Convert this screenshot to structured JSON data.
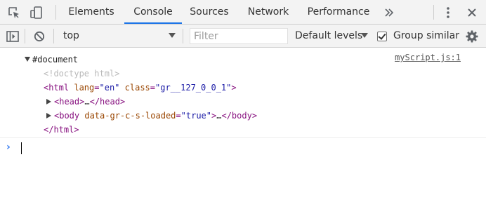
{
  "tabs": [
    {
      "label": "Elements",
      "active": false
    },
    {
      "label": "Console",
      "active": true
    },
    {
      "label": "Sources",
      "active": false
    },
    {
      "label": "Network",
      "active": false
    },
    {
      "label": "Performance",
      "active": false
    }
  ],
  "toolbar": {
    "context": "top",
    "filter_placeholder": "Filter",
    "levels": "Default levels",
    "group_similar": "Group similar",
    "group_similar_checked": true
  },
  "console": {
    "document_label": "#document",
    "source_link": "myScript.js:1",
    "doctype": "<!doctype html>",
    "html_open": {
      "tag_open": "<html",
      "attr1": "lang",
      "val1": "\"en\"",
      "attr2": "class",
      "val2": "\"gr__127_0_0_1\"",
      "tag_close": ">"
    },
    "head": {
      "open": "<head>",
      "ellipsis": "…",
      "close": "</head>"
    },
    "body": {
      "open": "<body",
      "attr": "data-gr-c-s-loaded",
      "val": "\"true\"",
      "gt": ">",
      "ellipsis": "…",
      "close": "</body>"
    },
    "html_close": "</html>",
    "prompt": "›"
  },
  "colors": {
    "accent": "#1a73e8",
    "tag": "#881280",
    "attr": "#994500",
    "value": "#1a1aa6",
    "prompt": "#367cf1"
  }
}
